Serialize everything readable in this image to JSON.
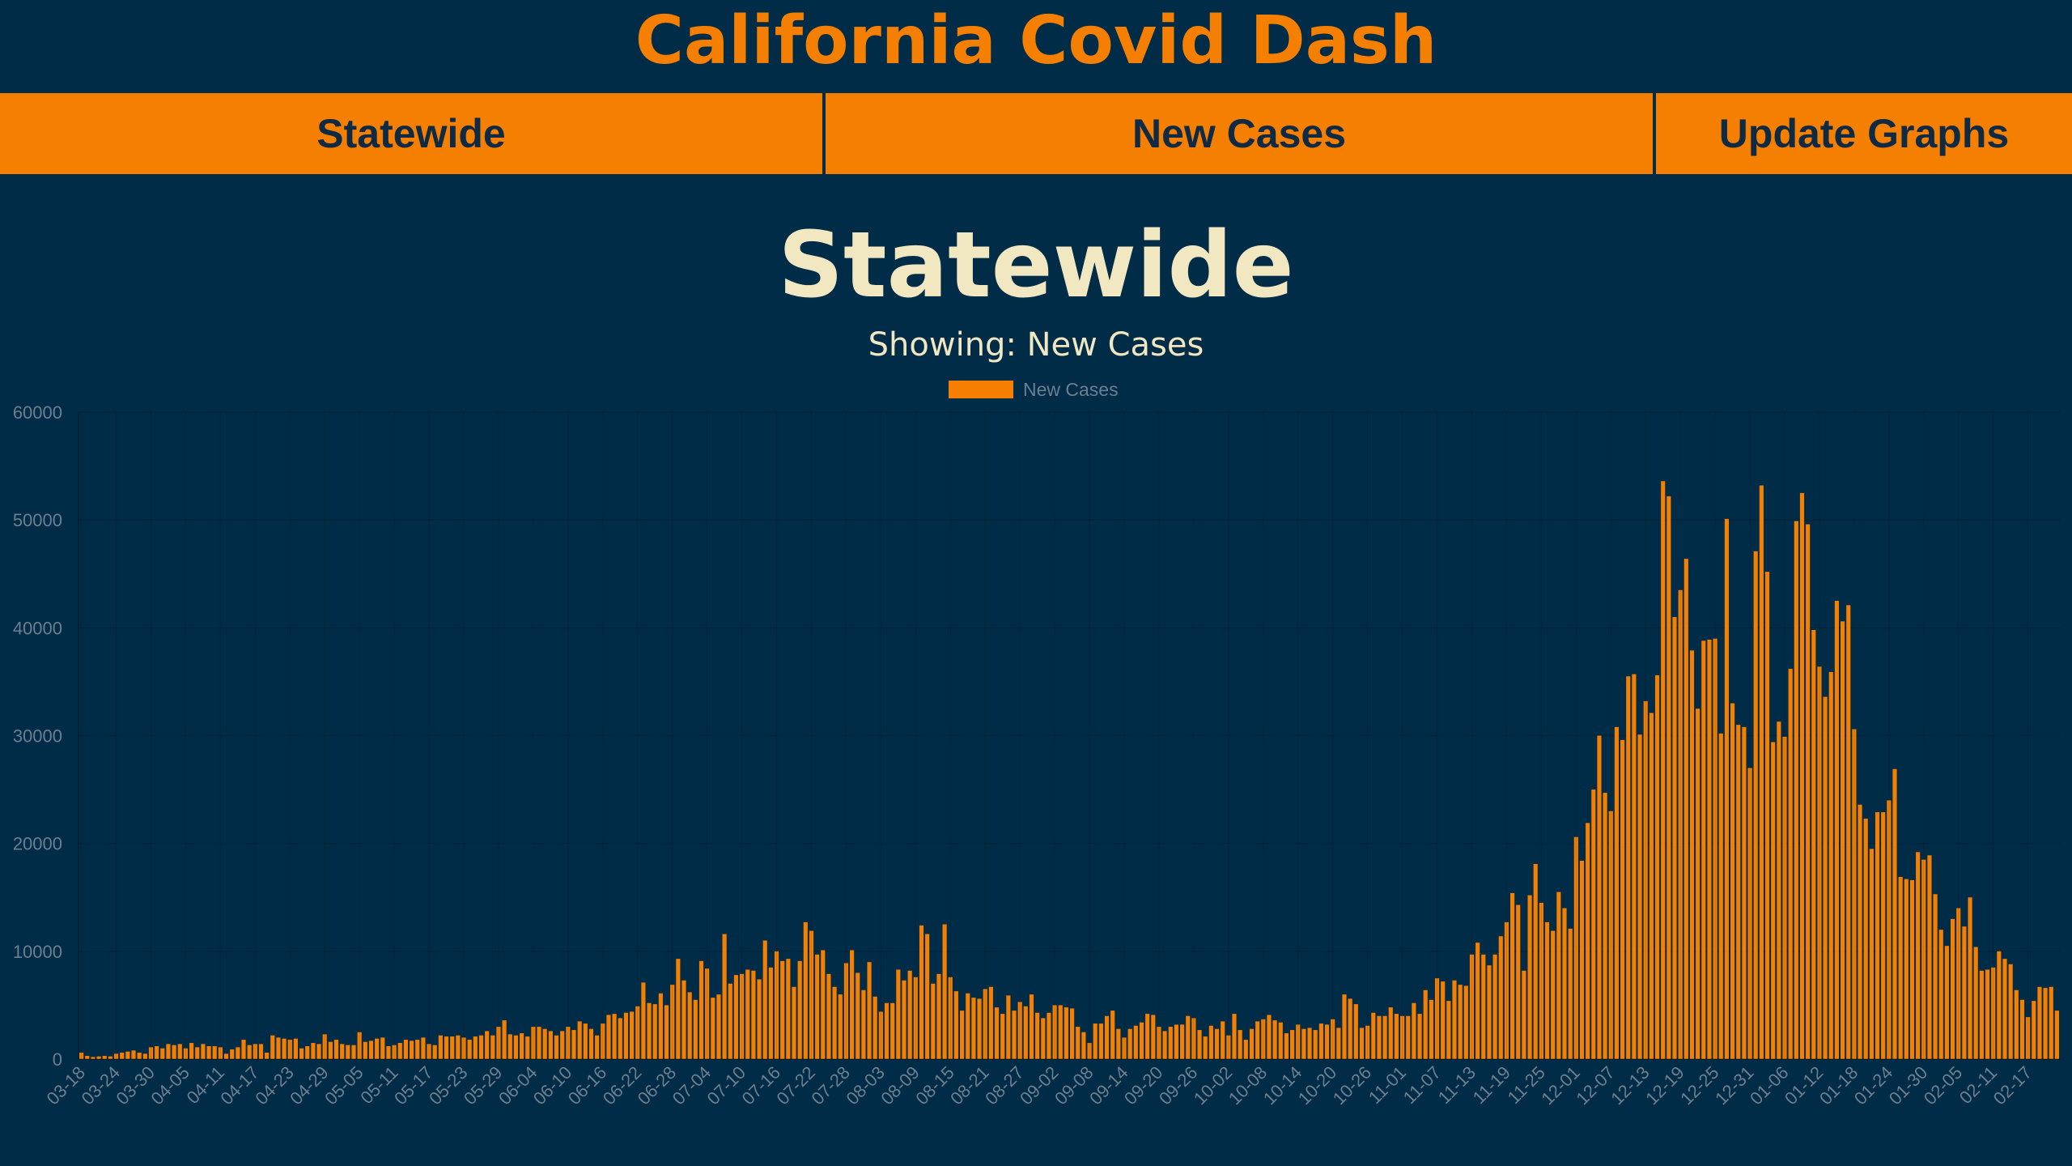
{
  "app": {
    "title": "California Covid Dash"
  },
  "nav": {
    "region_label": "Statewide",
    "metric_label": "New Cases",
    "update_label": "Update Graphs"
  },
  "page": {
    "title": "Statewide",
    "subtitle": "Showing: New Cases"
  },
  "colors": {
    "background": "#012c48",
    "accent": "#f57f00",
    "title_text": "#f1e8c2",
    "nav_text": "#0f2a44",
    "axis_text": "#6b7f8e"
  },
  "chart_data": {
    "type": "bar",
    "legend": [
      "New Cases"
    ],
    "legend_position": "top",
    "grid": true,
    "ylim": [
      0,
      60000
    ],
    "y_ticks": [
      0,
      10000,
      20000,
      30000,
      40000,
      50000,
      60000
    ],
    "x_tick_labels": [
      "03-18",
      "03-24",
      "03-30",
      "04-05",
      "04-11",
      "04-17",
      "04-23",
      "04-29",
      "05-05",
      "05-11",
      "05-17",
      "05-23",
      "05-29",
      "06-04",
      "06-10",
      "06-16",
      "06-22",
      "06-28",
      "07-04",
      "07-10",
      "07-16",
      "07-22",
      "07-28",
      "08-03",
      "08-09",
      "08-15",
      "08-21",
      "08-27",
      "09-02",
      "09-08",
      "09-14",
      "09-20",
      "09-26",
      "10-02",
      "10-08",
      "10-14",
      "10-20",
      "10-26",
      "11-01",
      "11-07",
      "11-13",
      "11-19",
      "11-25",
      "12-01",
      "12-07",
      "12-13",
      "12-19",
      "12-25",
      "12-31",
      "01-06",
      "01-12",
      "01-18",
      "01-24",
      "01-30",
      "02-05",
      "02-11",
      "02-17"
    ],
    "series": [
      {
        "name": "New Cases",
        "color": "#f57f00",
        "values": [
          600,
          300,
          200,
          250,
          300,
          250,
          500,
          600,
          700,
          800,
          600,
          500,
          1100,
          1200,
          1000,
          1400,
          1300,
          1400,
          1000,
          1500,
          1100,
          1400,
          1200,
          1200,
          1100,
          500,
          900,
          1100,
          1800,
          1300,
          1400,
          1400,
          600,
          2200,
          2000,
          1900,
          1800,
          1900,
          1000,
          1200,
          1500,
          1400,
          2300,
          1600,
          1800,
          1400,
          1300,
          1300,
          2500,
          1600,
          1700,
          1900,
          2000,
          1200,
          1300,
          1500,
          1800,
          1700,
          1800,
          2000,
          1400,
          1300,
          2200,
          2100,
          2100,
          2200,
          2000,
          1800,
          2100,
          2200,
          2600,
          2200,
          3000,
          3600,
          2300,
          2200,
          2400,
          2100,
          3000,
          3000,
          2800,
          2600,
          2200,
          2600,
          3000,
          2700,
          3500,
          3300,
          2800,
          2200,
          3300,
          4100,
          4200,
          3800,
          4300,
          4400,
          4900,
          7100,
          5200,
          5100,
          6100,
          5000,
          6900,
          9300,
          7300,
          6200,
          5500,
          9100,
          8400,
          5700,
          6000,
          11600,
          7000,
          7800,
          7900,
          8300,
          8200,
          7400,
          11000,
          8500,
          10000,
          9100,
          9300,
          6700,
          9100,
          12700,
          11900,
          9700,
          10100,
          7900,
          6700,
          6000,
          8900,
          10100,
          8000,
          6400,
          9000,
          5800,
          4400,
          5200,
          5200,
          8300,
          7300,
          8200,
          7600,
          12400,
          11600,
          7000,
          7900,
          12500,
          7600,
          6300,
          4500,
          6100,
          5700,
          5600,
          6500,
          6700,
          4800,
          4200,
          5900,
          4500,
          5300,
          4900,
          6000,
          4300,
          3800,
          4300,
          5000,
          5000,
          4800,
          4700,
          3000,
          2500,
          1500,
          3300,
          3300,
          4000,
          4500,
          2800,
          2000,
          2800,
          3100,
          3400,
          4200,
          4100,
          3000,
          2600,
          3000,
          3200,
          3200,
          4000,
          3800,
          2700,
          2100,
          3100,
          2800,
          3500,
          2200,
          4200,
          2700,
          1800,
          2800,
          3500,
          3700,
          4100,
          3600,
          3400,
          2400,
          2700,
          3200,
          2800,
          2900,
          2700,
          3300,
          3200,
          3700,
          2900,
          6000,
          5600,
          5100,
          2900,
          3100,
          4300,
          4000,
          4000,
          4800,
          4200,
          4000,
          4000,
          5200,
          4200,
          6400,
          5500,
          7500,
          7200,
          5400,
          7300,
          6900,
          6800,
          9700,
          10800,
          9700,
          8700,
          9700,
          11400,
          12700,
          15400,
          14300,
          8200,
          15200,
          18100,
          14500,
          12700,
          11900,
          15500,
          14000,
          12100,
          20600,
          18400,
          21900,
          25000,
          30000,
          24700,
          23000,
          30800,
          29600,
          35500,
          35700,
          30100,
          33200,
          32100,
          35600,
          53600,
          52200,
          41000,
          43500,
          46400,
          37900,
          32500,
          38800,
          38900,
          39000,
          30200,
          50100,
          33000,
          31000,
          30800,
          27000,
          47100,
          53200,
          45200,
          29400,
          31300,
          29900,
          36200,
          49900,
          52500,
          49600,
          39800,
          36400,
          33600,
          35900,
          42500,
          40600,
          42100,
          30600,
          23600,
          22300,
          19500,
          22900,
          22900,
          24000,
          26900,
          16900,
          16700,
          16600,
          19200,
          18500,
          18900,
          15300,
          12000,
          10500,
          13000,
          14000,
          12300,
          15000,
          10400,
          8200,
          8300,
          8500,
          10000,
          9300,
          8800,
          6400,
          5500,
          3900,
          5400,
          6700,
          6600,
          6700,
          4500
        ]
      }
    ]
  }
}
